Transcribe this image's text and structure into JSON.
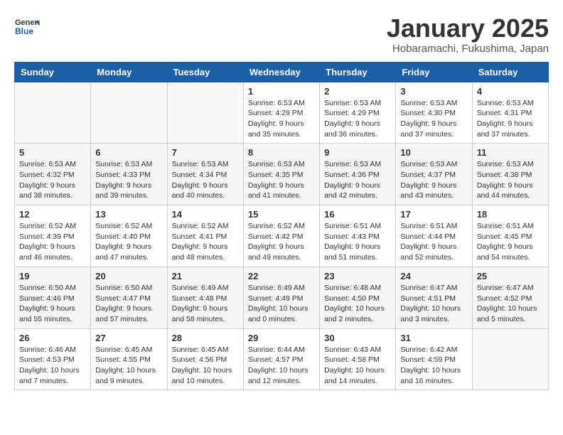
{
  "logo": {
    "text_general": "General",
    "text_blue": "Blue"
  },
  "header": {
    "month_title": "January 2025",
    "subtitle": "Hobaramachi, Fukushima, Japan"
  },
  "weekdays": [
    "Sunday",
    "Monday",
    "Tuesday",
    "Wednesday",
    "Thursday",
    "Friday",
    "Saturday"
  ],
  "weeks": [
    [
      {
        "day": "",
        "info": ""
      },
      {
        "day": "",
        "info": ""
      },
      {
        "day": "",
        "info": ""
      },
      {
        "day": "1",
        "info": "Sunrise: 6:53 AM\nSunset: 4:29 PM\nDaylight: 9 hours\nand 35 minutes."
      },
      {
        "day": "2",
        "info": "Sunrise: 6:53 AM\nSunset: 4:29 PM\nDaylight: 9 hours\nand 36 minutes."
      },
      {
        "day": "3",
        "info": "Sunrise: 6:53 AM\nSunset: 4:30 PM\nDaylight: 9 hours\nand 37 minutes."
      },
      {
        "day": "4",
        "info": "Sunrise: 6:53 AM\nSunset: 4:31 PM\nDaylight: 9 hours\nand 37 minutes."
      }
    ],
    [
      {
        "day": "5",
        "info": "Sunrise: 6:53 AM\nSunset: 4:32 PM\nDaylight: 9 hours\nand 38 minutes."
      },
      {
        "day": "6",
        "info": "Sunrise: 6:53 AM\nSunset: 4:33 PM\nDaylight: 9 hours\nand 39 minutes."
      },
      {
        "day": "7",
        "info": "Sunrise: 6:53 AM\nSunset: 4:34 PM\nDaylight: 9 hours\nand 40 minutes."
      },
      {
        "day": "8",
        "info": "Sunrise: 6:53 AM\nSunset: 4:35 PM\nDaylight: 9 hours\nand 41 minutes."
      },
      {
        "day": "9",
        "info": "Sunrise: 6:53 AM\nSunset: 4:36 PM\nDaylight: 9 hours\nand 42 minutes."
      },
      {
        "day": "10",
        "info": "Sunrise: 6:53 AM\nSunset: 4:37 PM\nDaylight: 9 hours\nand 43 minutes."
      },
      {
        "day": "11",
        "info": "Sunrise: 6:53 AM\nSunset: 4:38 PM\nDaylight: 9 hours\nand 44 minutes."
      }
    ],
    [
      {
        "day": "12",
        "info": "Sunrise: 6:52 AM\nSunset: 4:39 PM\nDaylight: 9 hours\nand 46 minutes."
      },
      {
        "day": "13",
        "info": "Sunrise: 6:52 AM\nSunset: 4:40 PM\nDaylight: 9 hours\nand 47 minutes."
      },
      {
        "day": "14",
        "info": "Sunrise: 6:52 AM\nSunset: 4:41 PM\nDaylight: 9 hours\nand 48 minutes."
      },
      {
        "day": "15",
        "info": "Sunrise: 6:52 AM\nSunset: 4:42 PM\nDaylight: 9 hours\nand 49 minutes."
      },
      {
        "day": "16",
        "info": "Sunrise: 6:51 AM\nSunset: 4:43 PM\nDaylight: 9 hours\nand 51 minutes."
      },
      {
        "day": "17",
        "info": "Sunrise: 6:51 AM\nSunset: 4:44 PM\nDaylight: 9 hours\nand 52 minutes."
      },
      {
        "day": "18",
        "info": "Sunrise: 6:51 AM\nSunset: 4:45 PM\nDaylight: 9 hours\nand 54 minutes."
      }
    ],
    [
      {
        "day": "19",
        "info": "Sunrise: 6:50 AM\nSunset: 4:46 PM\nDaylight: 9 hours\nand 55 minutes."
      },
      {
        "day": "20",
        "info": "Sunrise: 6:50 AM\nSunset: 4:47 PM\nDaylight: 9 hours\nand 57 minutes."
      },
      {
        "day": "21",
        "info": "Sunrise: 6:49 AM\nSunset: 4:48 PM\nDaylight: 9 hours\nand 58 minutes."
      },
      {
        "day": "22",
        "info": "Sunrise: 6:49 AM\nSunset: 4:49 PM\nDaylight: 10 hours\nand 0 minutes."
      },
      {
        "day": "23",
        "info": "Sunrise: 6:48 AM\nSunset: 4:50 PM\nDaylight: 10 hours\nand 2 minutes."
      },
      {
        "day": "24",
        "info": "Sunrise: 6:47 AM\nSunset: 4:51 PM\nDaylight: 10 hours\nand 3 minutes."
      },
      {
        "day": "25",
        "info": "Sunrise: 6:47 AM\nSunset: 4:52 PM\nDaylight: 10 hours\nand 5 minutes."
      }
    ],
    [
      {
        "day": "26",
        "info": "Sunrise: 6:46 AM\nSunset: 4:53 PM\nDaylight: 10 hours\nand 7 minutes."
      },
      {
        "day": "27",
        "info": "Sunrise: 6:45 AM\nSunset: 4:55 PM\nDaylight: 10 hours\nand 9 minutes."
      },
      {
        "day": "28",
        "info": "Sunrise: 6:45 AM\nSunset: 4:56 PM\nDaylight: 10 hours\nand 10 minutes."
      },
      {
        "day": "29",
        "info": "Sunrise: 6:44 AM\nSunset: 4:57 PM\nDaylight: 10 hours\nand 12 minutes."
      },
      {
        "day": "30",
        "info": "Sunrise: 6:43 AM\nSunset: 4:58 PM\nDaylight: 10 hours\nand 14 minutes."
      },
      {
        "day": "31",
        "info": "Sunrise: 6:42 AM\nSunset: 4:59 PM\nDaylight: 10 hours\nand 16 minutes."
      },
      {
        "day": "",
        "info": ""
      }
    ]
  ]
}
